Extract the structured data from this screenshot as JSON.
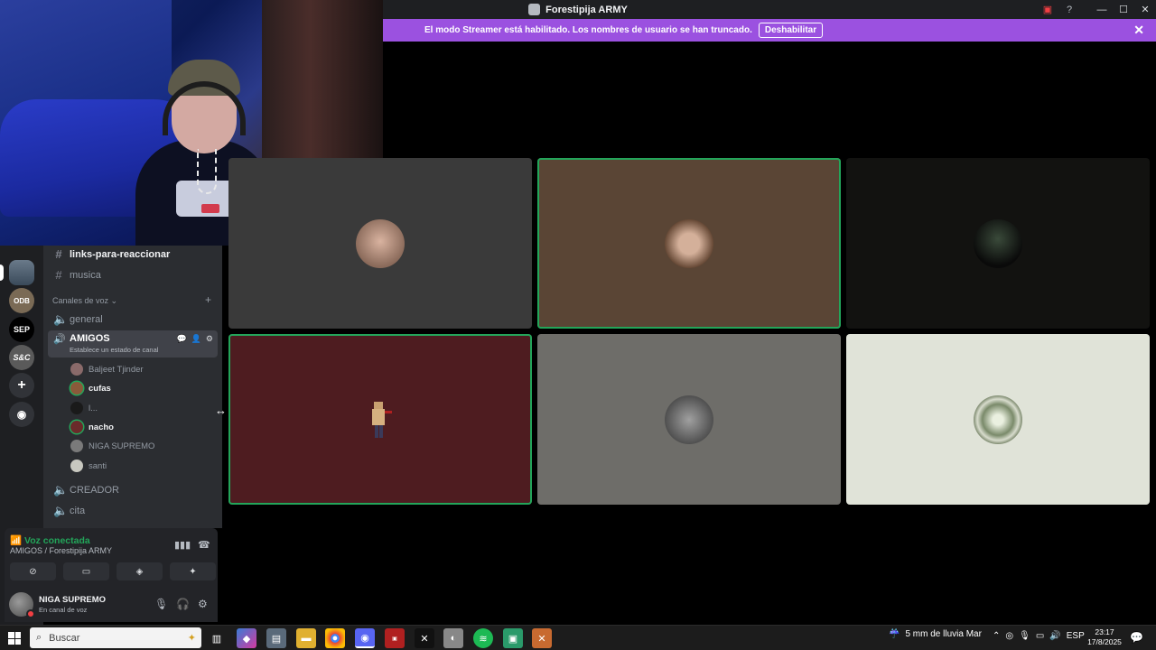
{
  "window": {
    "title": "Forestipija ARMY"
  },
  "banner": {
    "message": "El modo Streamer está habilitado. Los nombres de usuario se han truncado.",
    "button": "Deshabilitar"
  },
  "channels": {
    "text_channels": [
      "links-para-reaccionar",
      "musica"
    ],
    "voice_section": "Canales de voz",
    "voice_general": "general",
    "active": {
      "name": "AMIGOS",
      "status": "Establece un estado de canal"
    },
    "members": [
      {
        "name": "Baljeet Tjinder",
        "speaking": false
      },
      {
        "name": "cufas",
        "speaking": true
      },
      {
        "name": "l...",
        "speaking": false
      },
      {
        "name": "nacho",
        "speaking": true
      },
      {
        "name": "NIGA SUPREMO",
        "speaking": false
      },
      {
        "name": "santi",
        "speaking": false
      }
    ],
    "other_voice": [
      "CREADOR",
      "cita"
    ]
  },
  "servers": [
    "SEP"
  ],
  "voice_panel": {
    "status": "Voz conectada",
    "location": "AMIGOS / Forestipija ARMY"
  },
  "user": {
    "name": "NIGA SUPREMO",
    "status": "En canal de voz"
  },
  "tiles": [
    {
      "bg": "#3a3a3a",
      "speaking": false
    },
    {
      "bg": "#5a4535",
      "speaking": true
    },
    {
      "bg": "#121210",
      "speaking": false
    },
    {
      "bg": "#4e1c20",
      "speaking": true
    },
    {
      "bg": "#6e6d69",
      "speaking": false
    },
    {
      "bg": "#e0e3d8",
      "speaking": false
    }
  ],
  "taskbar": {
    "search_placeholder": "Buscar",
    "weather": "5 mm de lluvia Mar",
    "lang": "ESP",
    "time": "23:17",
    "date": "17/8/2025"
  },
  "colors": {
    "accent": "#9b51e0",
    "speaking": "#23a55a",
    "bg": "#000000"
  }
}
